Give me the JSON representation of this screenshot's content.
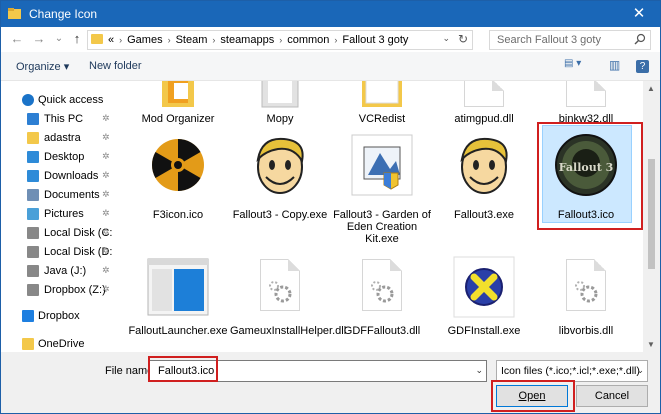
{
  "window": {
    "title": "Change Icon",
    "close_glyph": "✕"
  },
  "nav_buttons": {
    "back": "←",
    "forward": "→",
    "recent": "⌄",
    "up": "↑"
  },
  "address": {
    "crumbs": [
      "«",
      "Games",
      "Steam",
      "steamapps",
      "common",
      "Fallout 3 goty"
    ],
    "separator": "›",
    "dropdown": "⌄",
    "refresh": "↻"
  },
  "search": {
    "placeholder": "Search Fallout 3 goty",
    "icon": "search-icon"
  },
  "toolbar": {
    "organize": "Organize ▾",
    "new_folder": "New folder",
    "view": "▤ ▾",
    "pane": "▥",
    "help": "?"
  },
  "nav": {
    "items": [
      {
        "label": "Quick access",
        "icon": "star-icon",
        "pinned": false
      },
      {
        "label": "This PC",
        "icon": "pc-icon",
        "pinned": true
      },
      {
        "label": "adastra",
        "icon": "folder-icon",
        "pinned": true
      },
      {
        "label": "Desktop",
        "icon": "desktop-icon",
        "pinned": true
      },
      {
        "label": "Downloads",
        "icon": "download-icon",
        "pinned": true
      },
      {
        "label": "Documents",
        "icon": "documents-icon",
        "pinned": true
      },
      {
        "label": "Pictures",
        "icon": "pictures-icon",
        "pinned": true
      },
      {
        "label": "Local Disk (C:",
        "icon": "disk-icon",
        "pinned": true
      },
      {
        "label": "Local Disk (D:",
        "icon": "disk-icon",
        "pinned": true
      },
      {
        "label": "Java (J:)",
        "icon": "disk-icon",
        "pinned": true
      },
      {
        "label": "Dropbox (Z:)",
        "icon": "disk-icon",
        "pinned": true
      },
      {
        "label": "Dropbox",
        "icon": "dropbox-icon",
        "pinned": false
      },
      {
        "label": "OneDrive",
        "icon": "folder-icon",
        "pinned": false
      }
    ],
    "pin_glyph": "📌"
  },
  "files": {
    "row1": [
      "Mod Organizer",
      "Mopy",
      "VCRedist",
      "atimgpud.dll",
      "binkw32.dll"
    ],
    "row2": [
      {
        "label": "F3icon.ico",
        "kind": "hazard"
      },
      {
        "label": "Fallout3 - Copy.exe",
        "kind": "vaultboy"
      },
      {
        "label": "Fallout3 - Garden of Eden Creation Kit.exe",
        "kind": "installer"
      },
      {
        "label": "Fallout3.exe",
        "kind": "vaultboy"
      },
      {
        "label": "Fallout3.ico",
        "kind": "fallout-logo",
        "selected": true,
        "logo_text": "Fallout 3"
      }
    ],
    "row3": [
      {
        "label": "FalloutLauncher.exe",
        "kind": "window"
      },
      {
        "label": "GameuxInstallHelper.dll",
        "kind": "dll"
      },
      {
        "label": "GDFFallout3.dll",
        "kind": "dll"
      },
      {
        "label": "GDFInstall.exe",
        "kind": "gdf"
      },
      {
        "label": "libvorbis.dll",
        "kind": "dll"
      }
    ]
  },
  "scrollbar": {
    "up": "▲",
    "down": "▼"
  },
  "bottom": {
    "file_name_label": "File name:",
    "file_name_value": "Fallout3.ico",
    "filter": "Icon files (*.ico;*.icl;*.exe;*.dll)",
    "dropdown": "⌄",
    "open": "Open",
    "cancel": "Cancel"
  },
  "colors": {
    "titlebar": "#1a67b8",
    "selection": "#cce8ff",
    "highlight": "#d01f1f"
  }
}
